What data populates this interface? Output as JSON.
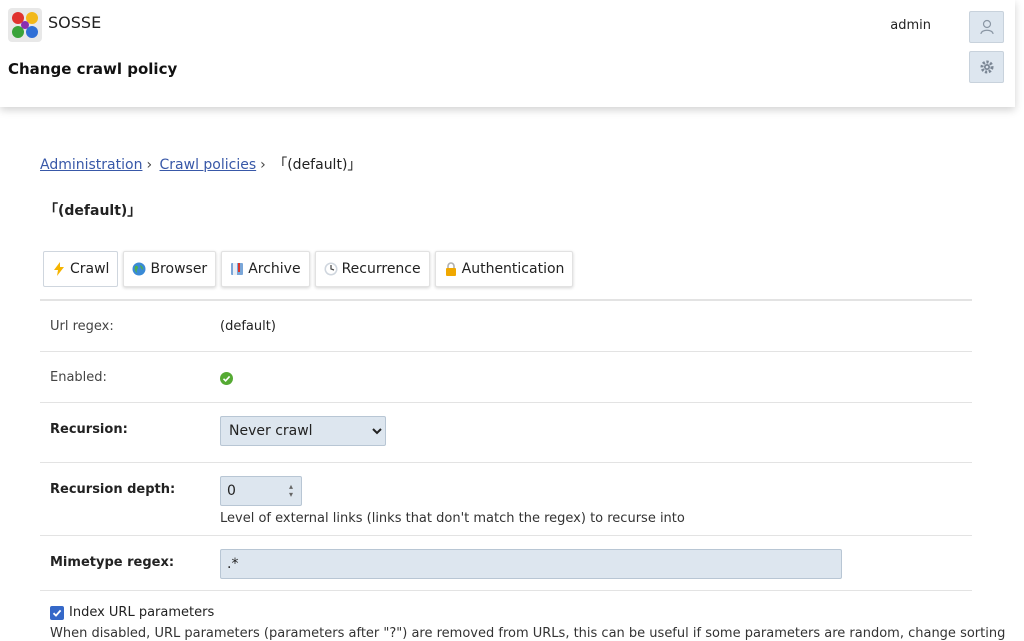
{
  "app": {
    "name": "SOSSE",
    "page_title": "Change crawl policy",
    "user": "admin"
  },
  "breadcrumb": {
    "items": [
      "Administration",
      "Crawl policies"
    ],
    "separator": "›",
    "current": "「(default)」"
  },
  "object_title": "「(default)」",
  "tabs": [
    {
      "label": "Crawl",
      "icon": "lightning-icon"
    },
    {
      "label": "Browser",
      "icon": "globe-icon"
    },
    {
      "label": "Archive",
      "icon": "book-icon"
    },
    {
      "label": "Recurrence",
      "icon": "clock-icon"
    },
    {
      "label": "Authentication",
      "icon": "lock-icon"
    }
  ],
  "form": {
    "url_regex": {
      "label": "Url regex:",
      "value": "(default)"
    },
    "enabled": {
      "label": "Enabled:",
      "value": true,
      "icon": "check-circle-icon"
    },
    "recursion": {
      "label": "Recursion:",
      "value": "Never crawl"
    },
    "recursion_depth": {
      "label": "Recursion depth:",
      "value": "0",
      "help": "Level of external links (links that don't match the regex) to recurse into"
    },
    "mimetype_regex": {
      "label": "Mimetype regex:",
      "value": ".*"
    },
    "index_url_params": {
      "label": "Index URL parameters",
      "checked": true,
      "help_visible": "When disabled, URL parameters (parameters after \"?\") are removed from URLs, this can be useful if some parameters are random, change sorting"
    }
  },
  "colors": {
    "accent": "#3568c8",
    "link": "#3858a8",
    "field_bg": "#dde6ef",
    "success": "#55aa33"
  }
}
